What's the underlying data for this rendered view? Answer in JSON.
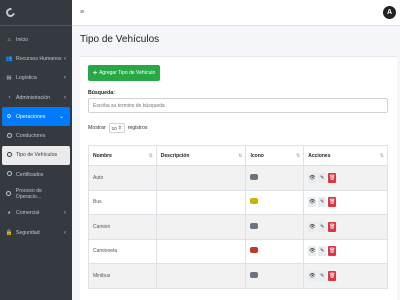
{
  "sidebar": {
    "items": [
      {
        "label": "Inicio",
        "icon": "home-icon",
        "glyph": "⌂",
        "chevron": ""
      },
      {
        "label": "Recursos Humanos",
        "icon": "users-icon",
        "glyph": "👥",
        "chevron": "‹"
      },
      {
        "label": "Logística",
        "icon": "box-icon",
        "glyph": "▤",
        "chevron": "‹"
      },
      {
        "label": "Administración",
        "icon": "tachometer-icon",
        "glyph": "◔",
        "chevron": "‹"
      },
      {
        "label": "Operaciones",
        "icon": "gear-icon",
        "glyph": "⚙",
        "chevron": "⌄"
      },
      {
        "label": "Conductores",
        "icon": "circle-icon",
        "glyph": "",
        "chevron": ""
      },
      {
        "label": "Tipo de Vehículos",
        "icon": "circle-icon",
        "glyph": "",
        "chevron": ""
      },
      {
        "label": "Certificados",
        "icon": "circle-icon",
        "glyph": "",
        "chevron": ""
      },
      {
        "label": "Proceso de Operacio...",
        "icon": "circle-icon",
        "glyph": "",
        "chevron": ""
      },
      {
        "label": "Comercial",
        "icon": "chart-pie-icon",
        "glyph": "◕",
        "chevron": "‹"
      },
      {
        "label": "Seguridad",
        "icon": "lock-icon",
        "glyph": "🔒",
        "chevron": "‹"
      }
    ]
  },
  "topbar": {
    "menu_glyph": "≡",
    "avatar_letter": "A"
  },
  "page": {
    "title": "Tipo de Vehículos"
  },
  "add_button": {
    "label": "Agregar Tipo de Vehículo",
    "glyph": "+"
  },
  "search": {
    "label": "Búsqueda:",
    "placeholder": "Escriba su termino de búsqueda"
  },
  "length": {
    "prefix": "Mostrar",
    "value": "10",
    "suffix": "registros"
  },
  "table": {
    "headers": [
      "Nombre",
      "Descripción",
      "Icono",
      "Acciones"
    ],
    "rows": [
      {
        "name": "Auto",
        "description": "",
        "icon_color": "#6c757d"
      },
      {
        "name": "Bus",
        "description": "",
        "icon_color": "#c8b400"
      },
      {
        "name": "Camion",
        "description": "",
        "icon_color": "#6c757d"
      },
      {
        "name": "Camioneta",
        "description": "",
        "icon_color": "#c0392b"
      },
      {
        "name": "Minibus",
        "description": "",
        "icon_color": "#6c757d"
      }
    ]
  },
  "colors": {
    "accent": "#007bff",
    "success": "#28a745",
    "danger": "#dc3545",
    "sidebar": "#343a40"
  }
}
